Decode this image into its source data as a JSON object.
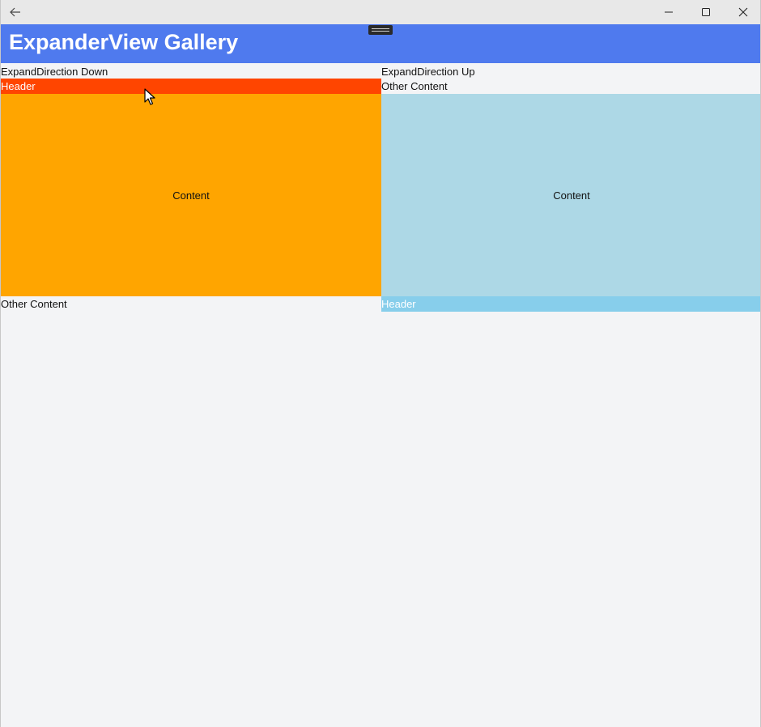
{
  "window": {
    "back_icon": "arrow-left-icon",
    "minimize_icon": "minimize-icon",
    "maximize_icon": "maximize-icon",
    "close_icon": "close-icon"
  },
  "app": {
    "title": "ExpanderView Gallery",
    "header_color": "#4f7aee"
  },
  "left_panel": {
    "label": "ExpandDirection Down",
    "header_label": "Header",
    "header_color": "#ff4500",
    "content_label": "Content",
    "content_color": "#ffa500",
    "other_content": "Other Content"
  },
  "right_panel": {
    "label": "ExpandDirection Up",
    "header_label": "Header",
    "header_color": "#87ceeb",
    "content_label": "Content",
    "content_color": "#add8e6",
    "other_content": "Other Content"
  }
}
